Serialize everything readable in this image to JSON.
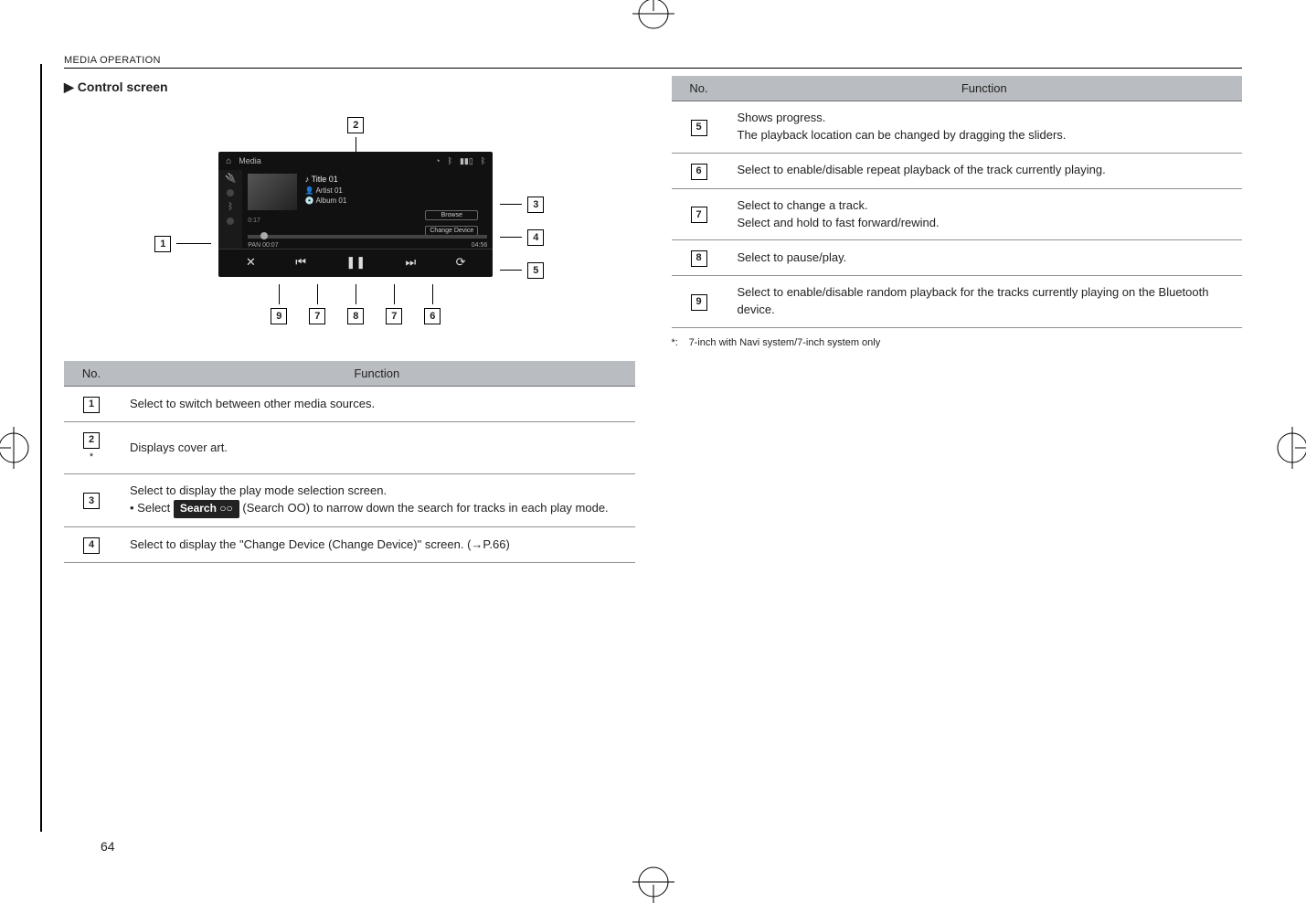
{
  "header": {
    "section": "MEDIA OPERATION"
  },
  "section_title": "Control screen",
  "shot": {
    "nav_label": "Media",
    "meta": {
      "title": "Title 01",
      "artist": "Artist 01",
      "album": "Album 01"
    },
    "btn_browse": "Browse",
    "btn_change": "Change Device",
    "time_current": "0:17",
    "time_total": "04:56",
    "pan_label": "PAN",
    "elapsed_small": "00:07"
  },
  "callouts": {
    "c1": "1",
    "c2": "2",
    "c3": "3",
    "c4": "4",
    "c5": "5",
    "c6": "6",
    "c7": "7",
    "c8": "8",
    "c9": "9"
  },
  "table_headers": {
    "no": "No.",
    "function": "Function"
  },
  "left_table": {
    "r1": {
      "desc": "Select to switch between other media sources."
    },
    "r2": {
      "desc": "Displays cover art.",
      "star": "*"
    },
    "r3": {
      "line1": "Select to display the play mode selection screen.",
      "bullet_prefix": "• Select ",
      "pill_text": "Search ○○",
      "bullet_after": " (Search OO) to narrow down the search for tracks in each play mode."
    },
    "r4": {
      "desc": "Select to display the \"Change Device (Change Device)\" screen. (→P.66)"
    }
  },
  "right_table": {
    "r5": {
      "desc": "Shows progress.\nThe playback location can be changed by dragging the sliders."
    },
    "r6": {
      "desc": "Select to enable/disable repeat playback of the track currently playing."
    },
    "r7": {
      "desc": "Select to change a track.\nSelect and hold to fast forward/rewind."
    },
    "r8": {
      "desc": "Select to pause/play."
    },
    "r9": {
      "desc": "Select to enable/disable random playback for the tracks currently playing on the Bluetooth device."
    }
  },
  "footnote": {
    "symbol": "*:",
    "text": "7-inch with Navi system/7-inch system only"
  },
  "page_number": "64"
}
